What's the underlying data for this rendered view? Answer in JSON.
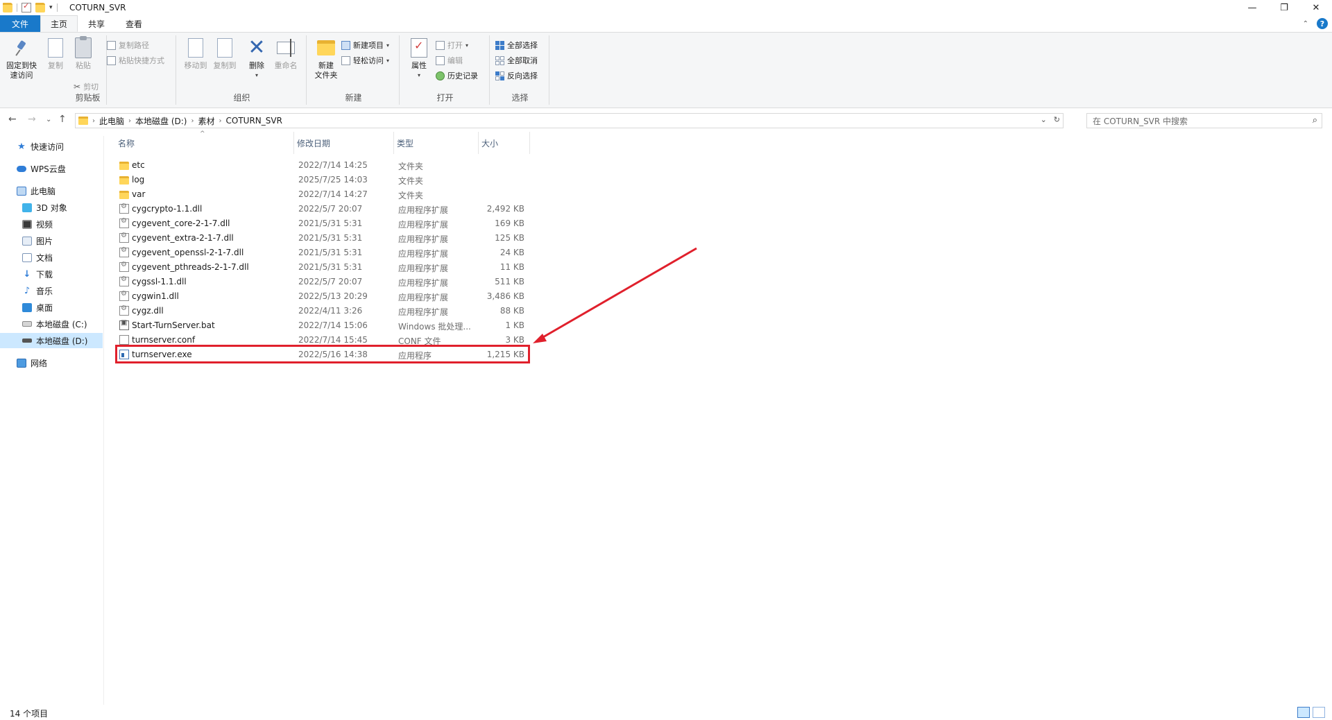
{
  "window": {
    "title": "COTURN_SVR",
    "controls": [
      "—",
      "❐",
      "✕"
    ]
  },
  "ribbon_tabs": [
    "文件",
    "主页",
    "共享",
    "查看"
  ],
  "ribbon": {
    "clipboard": {
      "label": "剪贴板",
      "pin_l1": "固定到快",
      "pin_l2": "速访问",
      "copy": "复制",
      "paste": "粘贴",
      "copy_path": "复制路径",
      "paste_shortcut": "粘贴快捷方式",
      "cut": "剪切"
    },
    "organize": {
      "label": "组织",
      "move_to": "移动到",
      "copy_to": "复制到",
      "delete": "删除",
      "rename": "重命名"
    },
    "new": {
      "label": "新建",
      "new_folder_l1": "新建",
      "new_folder_l2": "文件夹",
      "new_item": "新建项目",
      "easy_access": "轻松访问"
    },
    "open": {
      "label": "打开",
      "properties": "属性",
      "open": "打开",
      "edit": "编辑",
      "history": "历史记录"
    },
    "select": {
      "label": "选择",
      "select_all": "全部选择",
      "select_none": "全部取消",
      "invert": "反向选择"
    }
  },
  "address": {
    "crumbs": [
      "此电脑",
      "本地磁盘 (D:)",
      "素材",
      "COTURN_SVR"
    ],
    "search_placeholder": "在 COTURN_SVR 中搜索"
  },
  "sidebar": {
    "items": [
      {
        "label": "快速访问",
        "icon": "star-icon"
      },
      {
        "label": "WPS云盘",
        "icon": "cloud-icon"
      },
      {
        "label": "此电脑",
        "icon": "computer-icon"
      },
      {
        "label": "3D 对象",
        "icon": "cube-icon"
      },
      {
        "label": "视频",
        "icon": "video-icon"
      },
      {
        "label": "图片",
        "icon": "picture-icon"
      },
      {
        "label": "文档",
        "icon": "document-icon"
      },
      {
        "label": "下载",
        "icon": "download-icon"
      },
      {
        "label": "音乐",
        "icon": "music-icon"
      },
      {
        "label": "桌面",
        "icon": "desktop-icon"
      },
      {
        "label": "本地磁盘 (C:)",
        "icon": "drive-icon"
      },
      {
        "label": "本地磁盘 (D:)",
        "icon": "drive-icon"
      },
      {
        "label": "网络",
        "icon": "network-icon"
      }
    ]
  },
  "columns": {
    "name": "名称",
    "date": "修改日期",
    "type": "类型",
    "size": "大小"
  },
  "files": [
    {
      "name": "etc",
      "date": "2022/7/14 14:25",
      "type": "文件夹",
      "size": "",
      "kind": "folder"
    },
    {
      "name": "log",
      "date": "2025/7/25 14:03",
      "type": "文件夹",
      "size": "",
      "kind": "folder"
    },
    {
      "name": "var",
      "date": "2022/7/14 14:27",
      "type": "文件夹",
      "size": "",
      "kind": "folder"
    },
    {
      "name": "cygcrypto-1.1.dll",
      "date": "2022/5/7 20:07",
      "type": "应用程序扩展",
      "size": "2,492 KB",
      "kind": "dll"
    },
    {
      "name": "cygevent_core-2-1-7.dll",
      "date": "2021/5/31 5:31",
      "type": "应用程序扩展",
      "size": "169 KB",
      "kind": "dll"
    },
    {
      "name": "cygevent_extra-2-1-7.dll",
      "date": "2021/5/31 5:31",
      "type": "应用程序扩展",
      "size": "125 KB",
      "kind": "dll"
    },
    {
      "name": "cygevent_openssl-2-1-7.dll",
      "date": "2021/5/31 5:31",
      "type": "应用程序扩展",
      "size": "24 KB",
      "kind": "dll"
    },
    {
      "name": "cygevent_pthreads-2-1-7.dll",
      "date": "2021/5/31 5:31",
      "type": "应用程序扩展",
      "size": "11 KB",
      "kind": "dll"
    },
    {
      "name": "cygssl-1.1.dll",
      "date": "2022/5/7 20:07",
      "type": "应用程序扩展",
      "size": "511 KB",
      "kind": "dll"
    },
    {
      "name": "cygwin1.dll",
      "date": "2022/5/13 20:29",
      "type": "应用程序扩展",
      "size": "3,486 KB",
      "kind": "dll"
    },
    {
      "name": "cygz.dll",
      "date": "2022/4/11 3:26",
      "type": "应用程序扩展",
      "size": "88 KB",
      "kind": "dll"
    },
    {
      "name": "Start-TurnServer.bat",
      "date": "2022/7/14 15:06",
      "type": "Windows 批处理...",
      "size": "1 KB",
      "kind": "bat"
    },
    {
      "name": "turnserver.conf",
      "date": "2022/7/14 15:45",
      "type": "CONF 文件",
      "size": "3 KB",
      "kind": "conf"
    },
    {
      "name": "turnserver.exe",
      "date": "2022/5/16 14:38",
      "type": "应用程序",
      "size": "1,215 KB",
      "kind": "exe"
    }
  ],
  "status": {
    "count": "14 个项目"
  },
  "colors": {
    "accent": "#1979ca",
    "annotation": "#e0202c",
    "selection": "#cce8ff"
  }
}
